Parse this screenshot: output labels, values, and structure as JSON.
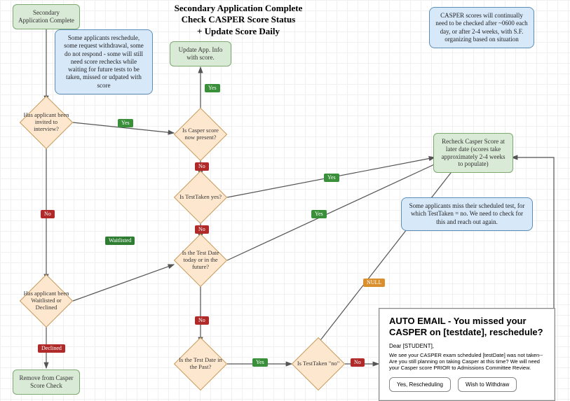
{
  "title": "Secondary Application Complete\nCheck CASPER Score Status\n+ Update Score Daily",
  "notes": {
    "reschedule": "Some applicants reschedule, some request withdrawal, some do not respond - some will still need score rechecks while waiting for future tests to be taken, missed or udpated with score",
    "daily_check": "CASPER scores will continually need to be checked after ~0600 each day, or after 2-4 weeks, with S.F. organizing based on situation",
    "missed_test": "Some applicants miss their scheduled test, for which TestTaken = no. We need to check for this and reach out again."
  },
  "nodes": {
    "secondary_complete": "Secondary Application Complete",
    "update_app": "Update App. Info with score.",
    "recheck": "Recheck Casper Score at later date (scores take approximately 2-4 weeks to populate)",
    "remove": "Remove from Casper Score Check"
  },
  "decisions": {
    "invited": "Has applicant been invited to interview?",
    "score_present": "Is Casper score now present?",
    "testtaken_yes": "Is TestTaken yes?",
    "date_future": "Is the Test Date today or in the future?",
    "waitlisted": "Has applicant been Waitlisted or Declined",
    "date_past": "Is the Test Date in the Past?",
    "testtaken_no": "Is TestTaken \"no\""
  },
  "labels": {
    "yes": "Yes",
    "no": "No",
    "null": "NULL",
    "waitlisted": "Waitlisted",
    "declined": "Declined"
  },
  "email": {
    "subject": "AUTO EMAIL - You missed your CASPER on [testdate], reschedule?",
    "salutation": "Dear [STUDENT],",
    "body": "We see your CASPER exam scheduled [testDate] was not taken-- Are you still planning on taking Casper at this time? We will need your Casper score PRIOR to Admissions Committee Review.",
    "btn_yes": "Yes, Rescheduling",
    "btn_withdraw": "Wish to Withdraw"
  },
  "chart_data": {
    "type": "flowchart",
    "nodes": [
      {
        "id": "start",
        "kind": "process",
        "label": "Secondary Application Complete"
      },
      {
        "id": "invited",
        "kind": "decision",
        "label": "Has applicant been invited to interview?"
      },
      {
        "id": "score_present",
        "kind": "decision",
        "label": "Is Casper score now present?"
      },
      {
        "id": "update",
        "kind": "process",
        "label": "Update App. Info with score."
      },
      {
        "id": "testtaken_yes",
        "kind": "decision",
        "label": "Is TestTaken yes?"
      },
      {
        "id": "date_future",
        "kind": "decision",
        "label": "Is the Test Date today or in the future?"
      },
      {
        "id": "recheck",
        "kind": "process",
        "label": "Recheck Casper Score at later date (scores take approximately 2-4 weeks to populate)"
      },
      {
        "id": "waitlisted",
        "kind": "decision",
        "label": "Has applicant been Waitlisted or Declined"
      },
      {
        "id": "remove",
        "kind": "process",
        "label": "Remove from Casper Score Check"
      },
      {
        "id": "date_past",
        "kind": "decision",
        "label": "Is the Test Date in the Past?"
      },
      {
        "id": "testtaken_no",
        "kind": "decision",
        "label": "Is TestTaken \"no\""
      },
      {
        "id": "email",
        "kind": "terminal",
        "label": "AUTO EMAIL - You missed your CASPER on [testdate], reschedule?"
      }
    ],
    "edges": [
      {
        "from": "start",
        "to": "invited",
        "label": ""
      },
      {
        "from": "invited",
        "to": "score_present",
        "label": "Yes"
      },
      {
        "from": "invited",
        "to": "waitlisted",
        "label": "No"
      },
      {
        "from": "score_present",
        "to": "update",
        "label": "Yes"
      },
      {
        "from": "score_present",
        "to": "testtaken_yes",
        "label": "No"
      },
      {
        "from": "testtaken_yes",
        "to": "recheck",
        "label": "Yes"
      },
      {
        "from": "testtaken_yes",
        "to": "date_future",
        "label": "No"
      },
      {
        "from": "date_future",
        "to": "recheck",
        "label": "Yes"
      },
      {
        "from": "date_future",
        "to": "date_past",
        "label": "No"
      },
      {
        "from": "waitlisted",
        "to": "date_future",
        "label": "Waitlisted"
      },
      {
        "from": "waitlisted",
        "to": "remove",
        "label": "Declined"
      },
      {
        "from": "date_past",
        "to": "testtaken_no",
        "label": "Yes"
      },
      {
        "from": "testtaken_no",
        "to": "email",
        "label": "No"
      },
      {
        "from": "testtaken_no",
        "to": "recheck",
        "label": "NULL"
      },
      {
        "from": "email",
        "to": "recheck",
        "label": ""
      }
    ],
    "annotations": [
      "Some applicants reschedule, some request withdrawal, some do not respond - some will still need score rechecks while waiting for future tests to be taken, missed or udpated with score",
      "CASPER scores will continually need to be checked after ~0600 each day, or after 2-4 weeks, with S.F. organizing based on situation",
      "Some applicants miss their scheduled test, for which TestTaken = no. We need to check for this and reach out again."
    ]
  }
}
